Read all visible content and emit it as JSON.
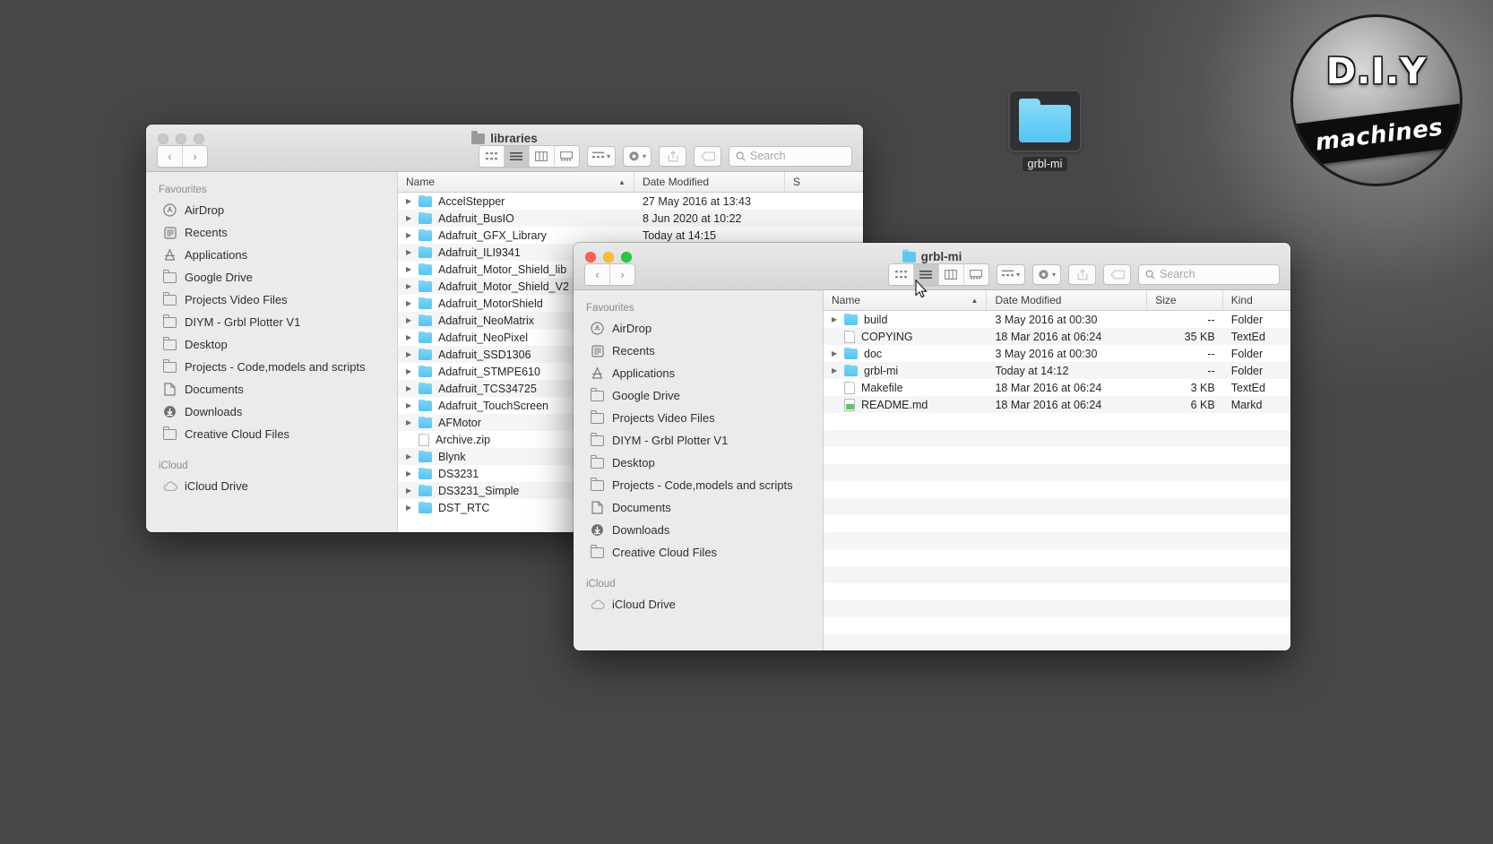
{
  "desktop": {
    "icon": {
      "label": "grbl-mi",
      "icon": "folder-icon"
    },
    "logo": {
      "line1": "D.I.Y",
      "line2": "machines"
    }
  },
  "windows": [
    {
      "id": "libraries",
      "title": "libraries",
      "title_icon": "folder-icon",
      "toolbar": {
        "back_icon": "chevron-left-icon",
        "forward_icon": "chevron-right-icon",
        "view_icon_grid": "icon-view-icon",
        "view_list": "list-view-icon",
        "view_columns": "column-view-icon",
        "view_gallery": "gallery-view-icon",
        "arrange_icon": "group-by-icon",
        "action_icon": "gear-icon",
        "share_icon": "share-icon",
        "tag_icon": "tag-icon",
        "search_icon": "search-icon",
        "search_placeholder": "Search",
        "search_value": ""
      },
      "sidebar": {
        "sections": [
          {
            "header": "Favourites",
            "items": [
              {
                "label": "AirDrop",
                "icon": "airdrop-icon"
              },
              {
                "label": "Recents",
                "icon": "recents-icon"
              },
              {
                "label": "Applications",
                "icon": "applications-icon"
              },
              {
                "label": "Google Drive",
                "icon": "folder-icon"
              },
              {
                "label": "Projects Video Files",
                "icon": "folder-icon"
              },
              {
                "label": "DIYM - Grbl Plotter V1",
                "icon": "folder-icon"
              },
              {
                "label": "Desktop",
                "icon": "folder-icon"
              },
              {
                "label": "Projects - Code,models and scripts",
                "icon": "folder-icon"
              },
              {
                "label": "Documents",
                "icon": "documents-icon"
              },
              {
                "label": "Downloads",
                "icon": "downloads-icon"
              },
              {
                "label": "Creative Cloud Files",
                "icon": "folder-icon"
              }
            ]
          },
          {
            "header": "iCloud",
            "items": [
              {
                "label": "iCloud Drive",
                "icon": "cloud-icon"
              }
            ]
          }
        ]
      },
      "columns": [
        "Name",
        "Date Modified",
        "S"
      ],
      "rows": [
        {
          "name": "AccelStepper",
          "icon": "folder-icon",
          "expandable": true,
          "date": "27 May 2016 at 13:43",
          "size": ""
        },
        {
          "name": "Adafruit_BusIO",
          "icon": "folder-icon",
          "expandable": true,
          "date": "8 Jun 2020 at 10:22",
          "size": ""
        },
        {
          "name": "Adafruit_GFX_Library",
          "icon": "folder-icon",
          "expandable": true,
          "date": "Today at 14:15",
          "size": ""
        },
        {
          "name": "Adafruit_ILI9341",
          "icon": "folder-icon",
          "expandable": true,
          "date": "",
          "size": ""
        },
        {
          "name": "Adafruit_Motor_Shield_lib",
          "icon": "folder-icon",
          "expandable": true,
          "date": "",
          "size": ""
        },
        {
          "name": "Adafruit_Motor_Shield_V2",
          "icon": "folder-icon",
          "expandable": true,
          "date": "",
          "size": ""
        },
        {
          "name": "Adafruit_MotorShield",
          "icon": "folder-icon",
          "expandable": true,
          "date": "",
          "size": ""
        },
        {
          "name": "Adafruit_NeoMatrix",
          "icon": "folder-icon",
          "expandable": true,
          "date": "",
          "size": ""
        },
        {
          "name": "Adafruit_NeoPixel",
          "icon": "folder-icon",
          "expandable": true,
          "date": "",
          "size": ""
        },
        {
          "name": "Adafruit_SSD1306",
          "icon": "folder-icon",
          "expandable": true,
          "date": "",
          "size": ""
        },
        {
          "name": "Adafruit_STMPE610",
          "icon": "folder-icon",
          "expandable": true,
          "date": "",
          "size": ""
        },
        {
          "name": "Adafruit_TCS34725",
          "icon": "folder-icon",
          "expandable": true,
          "date": "",
          "size": ""
        },
        {
          "name": "Adafruit_TouchScreen",
          "icon": "folder-icon",
          "expandable": true,
          "date": "",
          "size": ""
        },
        {
          "name": "AFMotor",
          "icon": "folder-icon",
          "expandable": true,
          "date": "",
          "size": ""
        },
        {
          "name": "Archive.zip",
          "icon": "document-icon",
          "expandable": false,
          "date": "",
          "size": ""
        },
        {
          "name": "Blynk",
          "icon": "folder-icon",
          "expandable": true,
          "date": "",
          "size": ""
        },
        {
          "name": "DS3231",
          "icon": "folder-icon",
          "expandable": true,
          "date": "",
          "size": ""
        },
        {
          "name": "DS3231_Simple",
          "icon": "folder-icon",
          "expandable": true,
          "date": "",
          "size": ""
        },
        {
          "name": "DST_RTC",
          "icon": "folder-icon",
          "expandable": true,
          "date": "",
          "size": ""
        }
      ]
    },
    {
      "id": "grbl",
      "title": "grbl-mi",
      "title_icon": "folder-icon",
      "toolbar": {
        "back_icon": "chevron-left-icon",
        "forward_icon": "chevron-right-icon",
        "view_icon_grid": "icon-view-icon",
        "view_list": "list-view-icon",
        "view_columns": "column-view-icon",
        "view_gallery": "gallery-view-icon",
        "arrange_icon": "group-by-icon",
        "action_icon": "gear-icon",
        "share_icon": "share-icon",
        "tag_icon": "tag-icon",
        "search_icon": "search-icon",
        "search_placeholder": "Search",
        "search_value": ""
      },
      "sidebar": {
        "sections": [
          {
            "header": "Favourites",
            "items": [
              {
                "label": "AirDrop",
                "icon": "airdrop-icon"
              },
              {
                "label": "Recents",
                "icon": "recents-icon"
              },
              {
                "label": "Applications",
                "icon": "applications-icon"
              },
              {
                "label": "Google Drive",
                "icon": "folder-icon"
              },
              {
                "label": "Projects Video Files",
                "icon": "folder-icon"
              },
              {
                "label": "DIYM - Grbl Plotter V1",
                "icon": "folder-icon"
              },
              {
                "label": "Desktop",
                "icon": "folder-icon"
              },
              {
                "label": "Projects - Code,models and scripts",
                "icon": "folder-icon"
              },
              {
                "label": "Documents",
                "icon": "documents-icon"
              },
              {
                "label": "Downloads",
                "icon": "downloads-icon"
              },
              {
                "label": "Creative Cloud Files",
                "icon": "folder-icon"
              }
            ]
          },
          {
            "header": "iCloud",
            "items": [
              {
                "label": "iCloud Drive",
                "icon": "cloud-icon"
              }
            ]
          }
        ]
      },
      "columns": [
        "Name",
        "Date Modified",
        "Size",
        "Kind"
      ],
      "rows": [
        {
          "name": "build",
          "icon": "folder-icon",
          "expandable": true,
          "date": "3 May 2016 at 00:30",
          "size": "--",
          "kind": "Folder"
        },
        {
          "name": "COPYING",
          "icon": "document-icon",
          "expandable": false,
          "date": "18 Mar 2016 at 06:24",
          "size": "35 KB",
          "kind": "TextEd"
        },
        {
          "name": "doc",
          "icon": "folder-icon",
          "expandable": true,
          "date": "3 May 2016 at 00:30",
          "size": "--",
          "kind": "Folder"
        },
        {
          "name": "grbl-mi",
          "icon": "folder-icon",
          "expandable": true,
          "date": "Today at 14:12",
          "size": "--",
          "kind": "Folder"
        },
        {
          "name": "Makefile",
          "icon": "document-icon",
          "expandable": false,
          "date": "18 Mar 2016 at 06:24",
          "size": "3 KB",
          "kind": "TextEd"
        },
        {
          "name": "README.md",
          "icon": "markdown-icon",
          "expandable": false,
          "date": "18 Mar 2016 at 06:24",
          "size": "6 KB",
          "kind": "Markd"
        }
      ]
    }
  ],
  "cursor": {
    "icon": "arrow-cursor-icon"
  },
  "colors": {
    "folder_blue": "#6dcff6",
    "desktop_grey": "#474747",
    "window_chrome": "#e3e3e3",
    "sidebar_grey": "#ebebeb"
  }
}
